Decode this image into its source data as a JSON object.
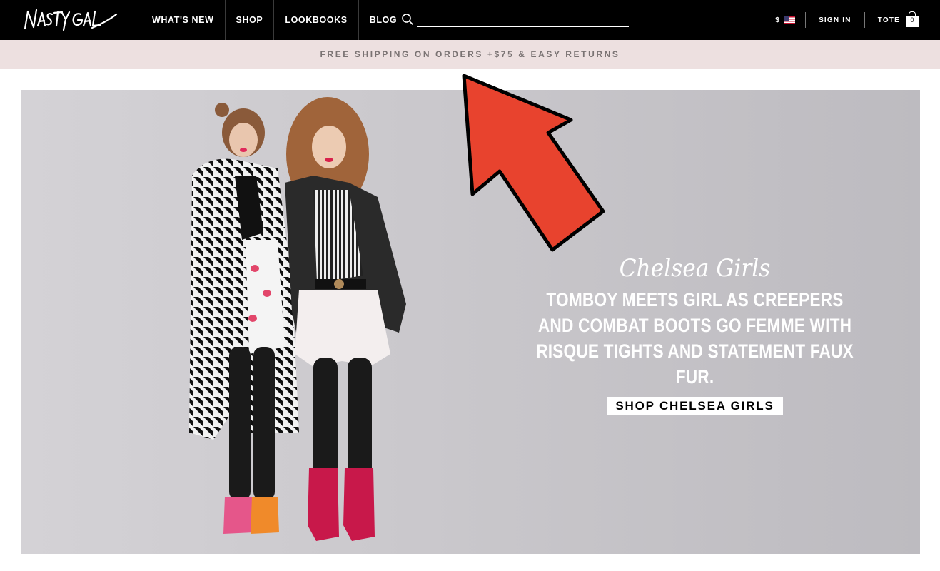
{
  "header": {
    "logo_text": "Nasty Gal",
    "nav": [
      "WHAT'S NEW",
      "SHOP",
      "LOOKBOOKS",
      "BLOG"
    ],
    "search_value": "",
    "currency": "$",
    "sign_in": "SIGN IN",
    "tote": "TOTE",
    "tote_count": "0"
  },
  "promo": {
    "text": "FREE SHIPPING ON ORDERS +$75 & EASY RETURNS"
  },
  "hero": {
    "script_title": "Chelsea Girls",
    "body": "TOMBOY MEETS GIRL AS CREEPERS AND COMBAT BOOTS GO FEMME WITH RISQUE TIGHTS AND STATEMENT FAUX FUR.",
    "cta": "SHOP CHELSEA GIRLS"
  },
  "annotation": {
    "arrow_color": "#e8432e"
  },
  "icons": {
    "search": "search-icon",
    "flag": "us-flag-icon",
    "bag": "shopping-bag-icon"
  }
}
